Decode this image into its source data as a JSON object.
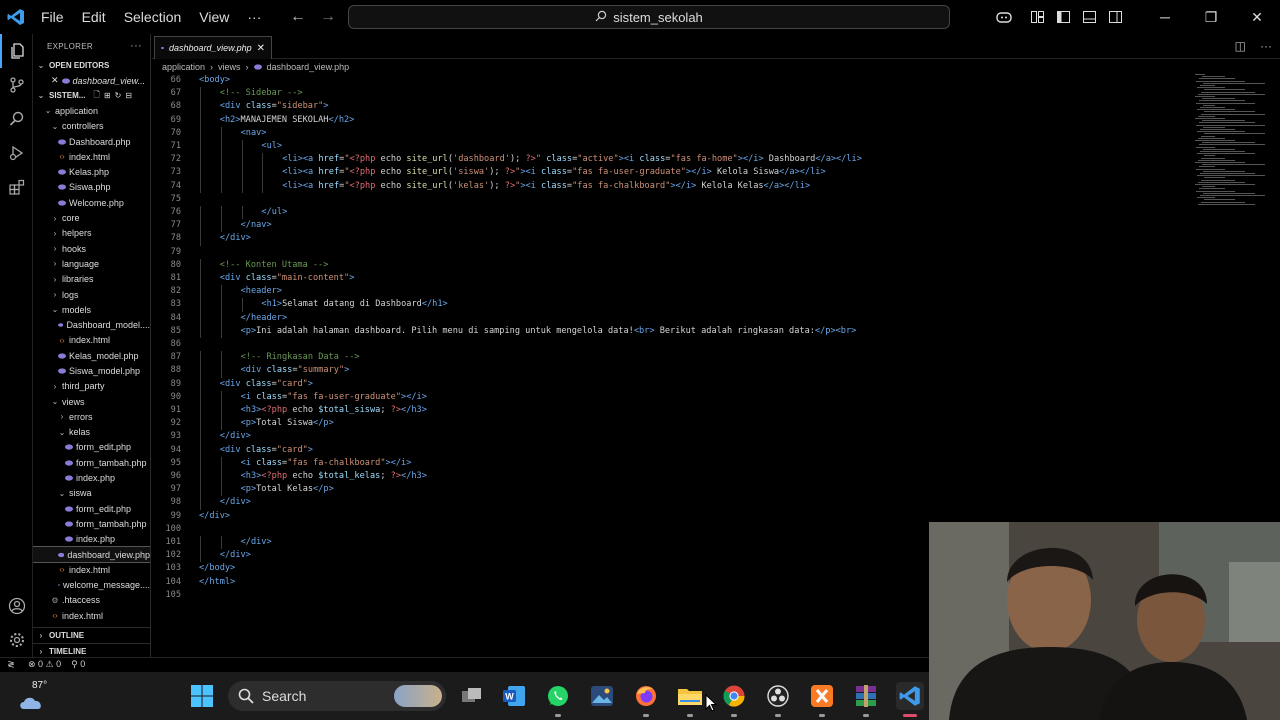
{
  "menu": {
    "file": "File",
    "edit": "Edit",
    "selection": "Selection",
    "view": "View",
    "more": "···"
  },
  "search": {
    "text": "sistem_sekolah"
  },
  "explorer": {
    "title": "EXPLORER",
    "more": "···",
    "open_editors_label": "OPEN EDITORS",
    "open_editor_file": "dashboard_view...",
    "project_label": "SISTEM...",
    "tree": [
      {
        "label": "application",
        "kind": "folder-open",
        "depth": 1
      },
      {
        "label": "controllers",
        "kind": "folder-open",
        "depth": 2
      },
      {
        "label": "Dashboard.php",
        "kind": "php",
        "depth": 3
      },
      {
        "label": "index.html",
        "kind": "html",
        "depth": 3
      },
      {
        "label": "Kelas.php",
        "kind": "php",
        "depth": 3
      },
      {
        "label": "Siswa.php",
        "kind": "php",
        "depth": 3
      },
      {
        "label": "Welcome.php",
        "kind": "php",
        "depth": 3
      },
      {
        "label": "core",
        "kind": "folder",
        "depth": 2
      },
      {
        "label": "helpers",
        "kind": "folder",
        "depth": 2
      },
      {
        "label": "hooks",
        "kind": "folder",
        "depth": 2
      },
      {
        "label": "language",
        "kind": "folder",
        "depth": 2
      },
      {
        "label": "libraries",
        "kind": "folder",
        "depth": 2
      },
      {
        "label": "logs",
        "kind": "folder",
        "depth": 2
      },
      {
        "label": "models",
        "kind": "folder-open",
        "depth": 2
      },
      {
        "label": "Dashboard_model....",
        "kind": "php",
        "depth": 3
      },
      {
        "label": "index.html",
        "kind": "html",
        "depth": 3
      },
      {
        "label": "Kelas_model.php",
        "kind": "php",
        "depth": 3
      },
      {
        "label": "Siswa_model.php",
        "kind": "php",
        "depth": 3
      },
      {
        "label": "third_party",
        "kind": "folder",
        "depth": 2
      },
      {
        "label": "views",
        "kind": "folder-open",
        "depth": 2
      },
      {
        "label": "errors",
        "kind": "folder",
        "depth": 3
      },
      {
        "label": "kelas",
        "kind": "folder-open",
        "depth": 3
      },
      {
        "label": "form_edit.php",
        "kind": "php",
        "depth": 4
      },
      {
        "label": "form_tambah.php",
        "kind": "php",
        "depth": 4
      },
      {
        "label": "index.php",
        "kind": "php",
        "depth": 4
      },
      {
        "label": "siswa",
        "kind": "folder-open",
        "depth": 3
      },
      {
        "label": "form_edit.php",
        "kind": "php",
        "depth": 4
      },
      {
        "label": "form_tambah.php",
        "kind": "php",
        "depth": 4
      },
      {
        "label": "index.php",
        "kind": "php",
        "depth": 4
      },
      {
        "label": "dashboard_view.php",
        "kind": "php",
        "depth": 3,
        "selected": true
      },
      {
        "label": "index.html",
        "kind": "html",
        "depth": 3
      },
      {
        "label": "welcome_message....",
        "kind": "php",
        "depth": 3
      },
      {
        "label": ".htaccess",
        "kind": "config",
        "depth": 2
      },
      {
        "label": "index.html",
        "kind": "html",
        "depth": 2
      }
    ],
    "outline_label": "OUTLINE",
    "timeline_label": "TIMELINE"
  },
  "tab": {
    "label": "dashboard_view.php",
    "close": "✕"
  },
  "breadcrumb": {
    "part1": "application",
    "part2": "views",
    "part3": "dashboard_view.php",
    "sep": "›"
  },
  "code_lines": [
    {
      "n": "66",
      "indent": 0,
      "html": "<span class='c-tag'>&lt;body&gt;</span>"
    },
    {
      "n": "67",
      "indent": 1,
      "html": "<span class='c-com'>&lt;!-- Sidebar --&gt;</span>"
    },
    {
      "n": "68",
      "indent": 1,
      "html": "<span class='c-tag'>&lt;div</span> <span class='c-attr'>class</span>=<span class='c-str'>\"sidebar\"</span><span class='c-tag'>&gt;</span>"
    },
    {
      "n": "69",
      "indent": 1,
      "html": "<span class='c-tag'>&lt;h2&gt;</span>MANAJEMEN SEKOLAH<span class='c-tag'>&lt;/h2&gt;</span>"
    },
    {
      "n": "70",
      "indent": 2,
      "html": "<span class='c-tag'>&lt;nav&gt;</span>"
    },
    {
      "n": "71",
      "indent": 3,
      "html": "<span class='c-tag'>&lt;ul&gt;</span>"
    },
    {
      "n": "72",
      "indent": 4,
      "html": "<span class='c-tag'>&lt;li&gt;&lt;a</span> <span class='c-attr'>href</span>=<span class='c-str'>\"</span><span class='c-php'>&lt;?php</span> echo <span class='c-fn'>site_url</span>(<span class='c-str'>'dashboard'</span>); <span class='c-php'>?&gt;</span><span class='c-str'>\"</span> <span class='c-attr'>class</span>=<span class='c-str'>\"active\"</span><span class='c-tag'>&gt;&lt;i</span> <span class='c-attr'>class</span>=<span class='c-str'>\"fas fa-home\"</span><span class='c-tag'>&gt;&lt;/i&gt;</span> Dashboard<span class='c-tag'>&lt;/a&gt;&lt;/li&gt;</span>"
    },
    {
      "n": "73",
      "indent": 4,
      "html": "<span class='c-tag'>&lt;li&gt;&lt;a</span> <span class='c-attr'>href</span>=<span class='c-str'>\"</span><span class='c-php'>&lt;?php</span> echo <span class='c-fn'>site_url</span>(<span class='c-str'>'siswa'</span>); <span class='c-php'>?&gt;</span><span class='c-str'>\"</span><span class='c-tag'>&gt;&lt;i</span> <span class='c-attr'>class</span>=<span class='c-str'>\"fas fa-user-graduate\"</span><span class='c-tag'>&gt;&lt;/i&gt;</span> Kelola Siswa<span class='c-tag'>&lt;/a&gt;&lt;/li&gt;</span>"
    },
    {
      "n": "74",
      "indent": 4,
      "html": "<span class='c-tag'>&lt;li&gt;&lt;a</span> <span class='c-attr'>href</span>=<span class='c-str'>\"</span><span class='c-php'>&lt;?php</span> echo <span class='c-fn'>site_url</span>(<span class='c-str'>'kelas'</span>); <span class='c-php'>?&gt;</span><span class='c-str'>\"</span><span class='c-tag'>&gt;&lt;i</span> <span class='c-attr'>class</span>=<span class='c-str'>\"fas fa-chalkboard\"</span><span class='c-tag'>&gt;&lt;/i&gt;</span> Kelola Kelas<span class='c-tag'>&lt;/a&gt;&lt;/li&gt;</span>"
    },
    {
      "n": "75",
      "indent": 0,
      "html": ""
    },
    {
      "n": "76",
      "indent": 3,
      "html": "<span class='c-tag'>&lt;/ul&gt;</span>"
    },
    {
      "n": "77",
      "indent": 2,
      "html": "<span class='c-tag'>&lt;/nav&gt;</span>"
    },
    {
      "n": "78",
      "indent": 1,
      "html": "<span class='c-tag'>&lt;/div&gt;</span>"
    },
    {
      "n": "79",
      "indent": 0,
      "html": ""
    },
    {
      "n": "80",
      "indent": 1,
      "html": "<span class='c-com'>&lt;!-- Konten Utama --&gt;</span>"
    },
    {
      "n": "81",
      "indent": 1,
      "html": "<span class='c-tag'>&lt;div</span> <span class='c-attr'>class</span>=<span class='c-str'>\"main-content\"</span><span class='c-tag'>&gt;</span>"
    },
    {
      "n": "82",
      "indent": 2,
      "html": "<span class='c-tag'>&lt;header&gt;</span>"
    },
    {
      "n": "83",
      "indent": 3,
      "html": "<span class='c-tag'>&lt;h1&gt;</span>Selamat datang di Dashboard<span class='c-tag'>&lt;/h1&gt;</span>"
    },
    {
      "n": "84",
      "indent": 2,
      "html": "<span class='c-tag'>&lt;/header&gt;</span>"
    },
    {
      "n": "85",
      "indent": 2,
      "html": "<span class='c-tag'>&lt;p&gt;</span>Ini adalah halaman dashboard. Pilih menu di samping untuk mengelola data!<span class='c-tag'>&lt;br&gt;</span> Berikut adalah ringkasan data:<span class='c-tag'>&lt;/p&gt;&lt;br&gt;</span>"
    },
    {
      "n": "86",
      "indent": 0,
      "html": ""
    },
    {
      "n": "87",
      "indent": 2,
      "html": "<span class='c-com'>&lt;!-- Ringkasan Data --&gt;</span>"
    },
    {
      "n": "88",
      "indent": 2,
      "html": "<span class='c-tag'>&lt;div</span> <span class='c-attr'>class</span>=<span class='c-str'>\"summary\"</span><span class='c-tag'>&gt;</span>"
    },
    {
      "n": "89",
      "indent": 1,
      "html": "<span class='c-tag'>&lt;div</span> <span class='c-attr'>class</span>=<span class='c-str'>\"card\"</span><span class='c-tag'>&gt;</span>"
    },
    {
      "n": "90",
      "indent": 2,
      "html": "<span class='c-tag'>&lt;i</span> <span class='c-attr'>class</span>=<span class='c-str'>\"fas fa-user-graduate\"</span><span class='c-tag'>&gt;&lt;/i&gt;</span>"
    },
    {
      "n": "91",
      "indent": 2,
      "html": "<span class='c-tag'>&lt;h3&gt;</span><span class='c-php'>&lt;?php</span> echo <span class='c-var'>$total_siswa</span>; <span class='c-php'>?&gt;</span><span class='c-tag'>&lt;/h3&gt;</span>"
    },
    {
      "n": "92",
      "indent": 2,
      "html": "<span class='c-tag'>&lt;p&gt;</span>Total Siswa<span class='c-tag'>&lt;/p&gt;</span>"
    },
    {
      "n": "93",
      "indent": 1,
      "html": "<span class='c-tag'>&lt;/div&gt;</span>"
    },
    {
      "n": "94",
      "indent": 1,
      "html": "<span class='c-tag'>&lt;div</span> <span class='c-attr'>class</span>=<span class='c-str'>\"card\"</span><span class='c-tag'>&gt;</span>"
    },
    {
      "n": "95",
      "indent": 2,
      "html": "<span class='c-tag'>&lt;i</span> <span class='c-attr'>class</span>=<span class='c-str'>\"fas fa-chalkboard\"</span><span class='c-tag'>&gt;&lt;/i&gt;</span>"
    },
    {
      "n": "96",
      "indent": 2,
      "html": "<span class='c-tag'>&lt;h3&gt;</span><span class='c-php'>&lt;?php</span> echo <span class='c-var'>$total_kelas</span>; <span class='c-php'>?&gt;</span><span class='c-tag'>&lt;/h3&gt;</span>"
    },
    {
      "n": "97",
      "indent": 2,
      "html": "<span class='c-tag'>&lt;p&gt;</span>Total Kelas<span class='c-tag'>&lt;/p&gt;</span>"
    },
    {
      "n": "98",
      "indent": 1,
      "html": "<span class='c-tag'>&lt;/div&gt;</span>"
    },
    {
      "n": "99",
      "indent": 0,
      "html": "<span class='c-tag'>&lt;/div&gt;</span>"
    },
    {
      "n": "100",
      "indent": 0,
      "html": ""
    },
    {
      "n": "101",
      "indent": 2,
      "html": "<span class='c-tag'>&lt;/div&gt;</span>"
    },
    {
      "n": "102",
      "indent": 1,
      "html": "<span class='c-tag'>&lt;/div&gt;</span>"
    },
    {
      "n": "103",
      "indent": 0,
      "html": "<span class='c-tag'>&lt;/body&gt;</span>"
    },
    {
      "n": "104",
      "indent": 0,
      "html": "<span class='c-tag'>&lt;/html&gt;</span>"
    },
    {
      "n": "105",
      "indent": 0,
      "html": ""
    }
  ],
  "status": {
    "remote": "≷",
    "errors": "⊗ 0 ⚠ 0",
    "ports": "⚲ 0"
  },
  "taskbar": {
    "temperature": "87°",
    "search_label": "Search",
    "apps": [
      "windows-start",
      "search",
      "task-view",
      "word",
      "whatsapp",
      "photos",
      "firefox",
      "file-explorer",
      "chrome",
      "obs",
      "xampp",
      "winrar",
      "vscode"
    ]
  },
  "colors": {
    "accent": "#4aa3ff",
    "php": "#8a7ad6",
    "html": "#e07b3b",
    "folder": "#c5a253"
  }
}
